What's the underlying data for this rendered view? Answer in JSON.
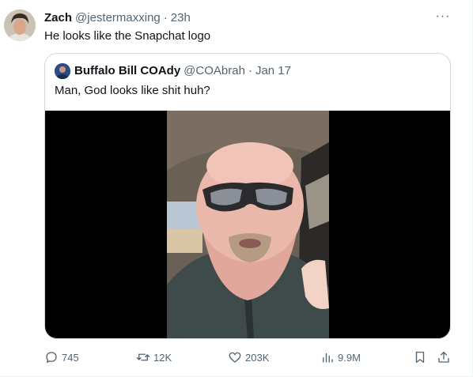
{
  "tweet": {
    "display_name": "Zach",
    "handle": "@jestermaxxing",
    "separator": "·",
    "time": "23h",
    "text": "He looks like the Snapchat logo",
    "more_label": "···"
  },
  "quote": {
    "display_name": "Buffalo Bill COAdy",
    "handle": "@COAbrah",
    "separator": "·",
    "date": "Jan 17",
    "text": "Man, God looks like shit huh?"
  },
  "actions": {
    "replies": "745",
    "reposts": "12K",
    "likes": "203K",
    "views": "9.9M"
  },
  "icons": [
    "avatar",
    "more-icon",
    "reply-icon",
    "repost-icon",
    "like-icon",
    "views-icon",
    "bookmark-icon",
    "share-icon"
  ],
  "colors": {
    "text": "#0f1419",
    "muted": "#536471",
    "border": "#cfd9de"
  }
}
